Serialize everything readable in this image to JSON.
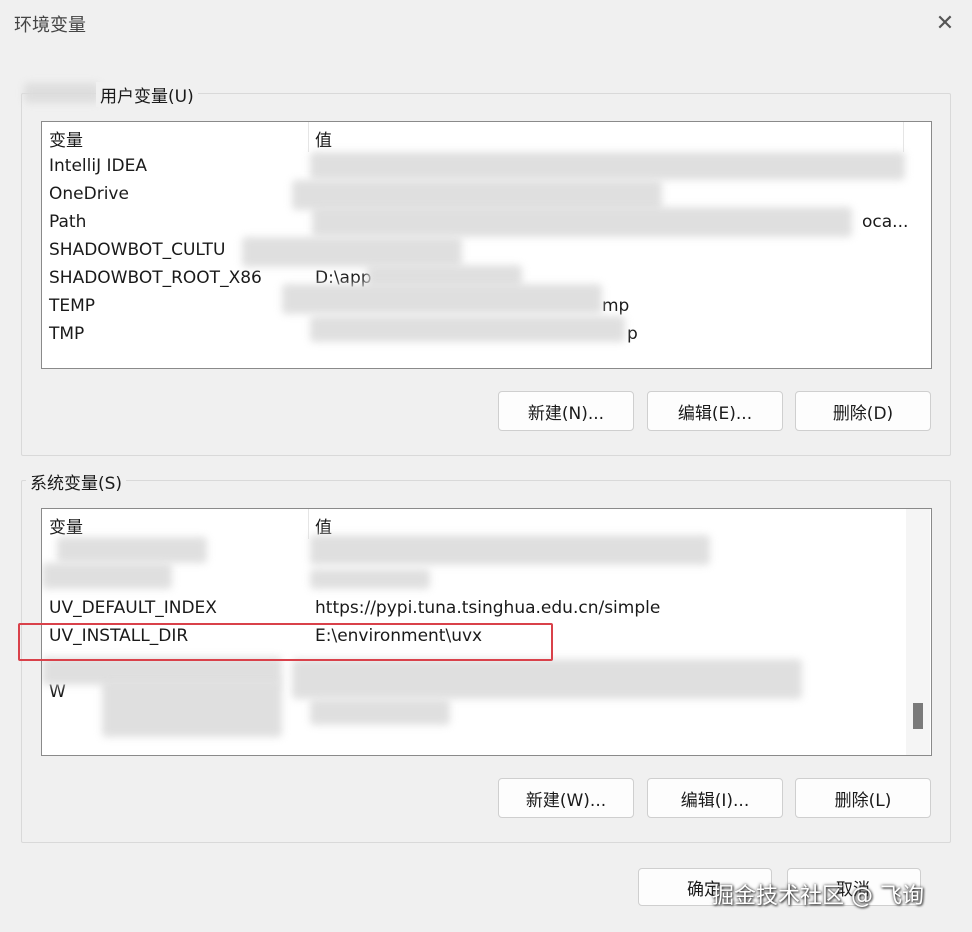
{
  "window": {
    "title": "环境变量",
    "close_glyph": "✕"
  },
  "user_vars": {
    "group_label": "用户变量(U)",
    "col_var": "变量",
    "col_val": "值",
    "rows": [
      {
        "name": "IntelliJ IDEA",
        "value": ""
      },
      {
        "name": "OneDrive",
        "value": ""
      },
      {
        "name": "Path",
        "value": "oca..."
      },
      {
        "name": "SHADOWBOT_CULTU",
        "value": ""
      },
      {
        "name": "SHADOWBOT_ROOT_X86",
        "value": "D:\\app"
      },
      {
        "name": "TEMP",
        "value": "mp"
      },
      {
        "name": "TMP",
        "value": "p"
      }
    ],
    "buttons": {
      "new": "新建(N)...",
      "edit": "编辑(E)...",
      "delete": "删除(D)"
    }
  },
  "system_vars": {
    "group_label": "系统变量(S)",
    "col_var": "变量",
    "col_val": "值",
    "rows": [
      {
        "name": "",
        "value": ""
      },
      {
        "name": "",
        "value": ""
      },
      {
        "name": "UV_DEFAULT_INDEX",
        "value": "https://pypi.tuna.tsinghua.edu.cn/simple"
      },
      {
        "name": "UV_INSTALL_DIR",
        "value": "E:\\environment\\uvx"
      },
      {
        "name": "",
        "value": ""
      },
      {
        "name": "W",
        "value": ""
      }
    ],
    "buttons": {
      "new": "新建(W)...",
      "edit": "编辑(I)...",
      "delete": "删除(L)"
    }
  },
  "footer": {
    "ok": "确定",
    "cancel": "取消"
  },
  "watermark": "掘金技术社区 @ 飞询",
  "colors": {
    "highlight": "#d9414a",
    "background": "#f0f0f0"
  }
}
